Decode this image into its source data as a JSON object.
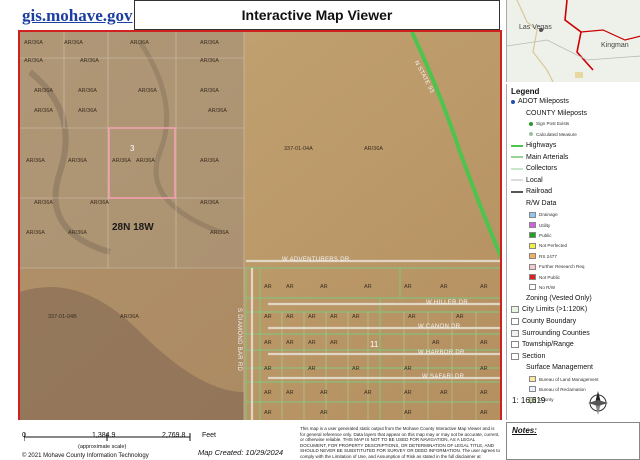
{
  "header": {
    "logo_text": "gis.mohave.gov",
    "title": "Interactive Map Viewer"
  },
  "inset_map": {
    "labels": [
      "Las Vegas",
      "Kingman"
    ]
  },
  "map": {
    "township_label": "28N 18W",
    "parcel_label": "AR/36A",
    "parcel_label_small": "AR",
    "parcel_id_a": "337-01-04A",
    "parcel_id_b": "337-01-04B",
    "highlight_number": "3",
    "section_number": "11",
    "roads": {
      "highway": "N STATE 93",
      "adventurers": "W ADVENTURERS DR",
      "hiller": "W HILLER DR",
      "kanon": "W CANON DR",
      "harbor": "W HARBOR DR",
      "safari": "W SAFARI DR",
      "diamond": "S DIAMOND BAR RD"
    },
    "colors": {
      "highlight": "#f2a0b0",
      "frame": "#d02020",
      "parcel_lines": "#7fc87f",
      "highway": "#4ec44e"
    }
  },
  "legend": {
    "title": "Legend",
    "items": [
      {
        "label": "ADOT Mileposts",
        "kind": "dot",
        "color": "#1f4fb0",
        "size": "normal"
      },
      {
        "label": "COUNTY Mileposts",
        "kind": "none",
        "color": "",
        "size": "normal"
      },
      {
        "label": "Sign Post Exists",
        "kind": "dot",
        "color": "#2a9a2a",
        "size": "small"
      },
      {
        "label": "Calculated Measure",
        "kind": "dot",
        "color": "#a0c0a0",
        "size": "small"
      },
      {
        "label": "Highways",
        "kind": "line",
        "color": "#4ec44e",
        "size": "normal"
      },
      {
        "label": "Main Arterials",
        "kind": "line",
        "color": "#9ad09a",
        "size": "normal"
      },
      {
        "label": "Collectors",
        "kind": "line",
        "color": "#c8e6c8",
        "size": "normal"
      },
      {
        "label": "Local",
        "kind": "line",
        "color": "#dddddd",
        "size": "normal"
      },
      {
        "label": "Railroad",
        "kind": "line",
        "color": "#555555",
        "size": "normal"
      },
      {
        "label": "R/W Data",
        "kind": "none",
        "color": "",
        "size": "normal"
      },
      {
        "label": "Drainage",
        "kind": "swatch",
        "color": "#8ec8f0",
        "size": "small"
      },
      {
        "label": "Utility",
        "kind": "swatch",
        "color": "#d060e0",
        "size": "small"
      },
      {
        "label": "Public",
        "kind": "swatch",
        "color": "#20a020",
        "size": "small"
      },
      {
        "label": "Not Perfected",
        "kind": "swatch",
        "color": "#f0f040",
        "size": "small"
      },
      {
        "label": "RS 2477",
        "kind": "swatch",
        "color": "#f0b060",
        "size": "small"
      },
      {
        "label": "Further Research Req",
        "kind": "swatch",
        "color": "#f8c8d0",
        "size": "small"
      },
      {
        "label": "Not Public",
        "kind": "swatch",
        "color": "#e02020",
        "size": "small"
      },
      {
        "label": "No R/W",
        "kind": "swatch",
        "color": "#ffffff",
        "size": "small"
      },
      {
        "label": "Zoning (Vested Only)",
        "kind": "none",
        "color": "",
        "size": "normal"
      },
      {
        "label": "City Limits (>1:120K)",
        "kind": "swatch",
        "color": "#e8f4e0",
        "size": "normal"
      },
      {
        "label": "County Boundary",
        "kind": "swatch",
        "color": "#ffffff",
        "size": "normal"
      },
      {
        "label": "Surrounding Counties",
        "kind": "swatch",
        "color": "#f0f0f0",
        "size": "normal"
      },
      {
        "label": "Township/Range",
        "kind": "swatch",
        "color": "#ffffff",
        "size": "normal"
      },
      {
        "label": "Section",
        "kind": "swatch",
        "color": "#ffffff",
        "size": "normal"
      },
      {
        "label": "Surface Management",
        "kind": "none",
        "color": "",
        "size": "normal"
      },
      {
        "label": "Bureau of Land Management",
        "kind": "swatch",
        "color": "#f8e8a0",
        "size": "small"
      },
      {
        "label": "Bureau of Reclamation",
        "kind": "swatch",
        "color": "#e8f0ff",
        "size": "small"
      },
      {
        "label": "County",
        "kind": "swatch",
        "color": "#c8e0a8",
        "size": "small"
      }
    ]
  },
  "scale": {
    "ratio": "1: 16,619",
    "tick_0": "0",
    "tick_1": "1,384.9",
    "tick_2": "2,769.8",
    "unit": "Feet",
    "note": "(approximate scale)",
    "copyright": "© 2021 Mohave County Information Technology"
  },
  "map_created": "Map Created: 10/29/2024",
  "disclaimer": "This map is a user generated static output from the Mohave County Interactive Map Viewer and is for general reference only. Data layers that appear on this map may or may not be accurate, current, or otherwise reliable. THIS MAP IS NOT TO BE USED FOR NAVIGATION, AS A LEGAL DOCUMENT, FOR PROPERTY DESCRIPTIONS, OR DETERMINATION OF LEGAL TITLE, AND SHOULD NEVER BE SUBSTITUTED FOR SURVEY OR DEED INFORMATION. The user agrees to comply with the Limitation of Use, and Assumption of Risk as stated in the full disclaimer at https://gis.mohave.gov",
  "notes": {
    "label": "Notes:"
  }
}
